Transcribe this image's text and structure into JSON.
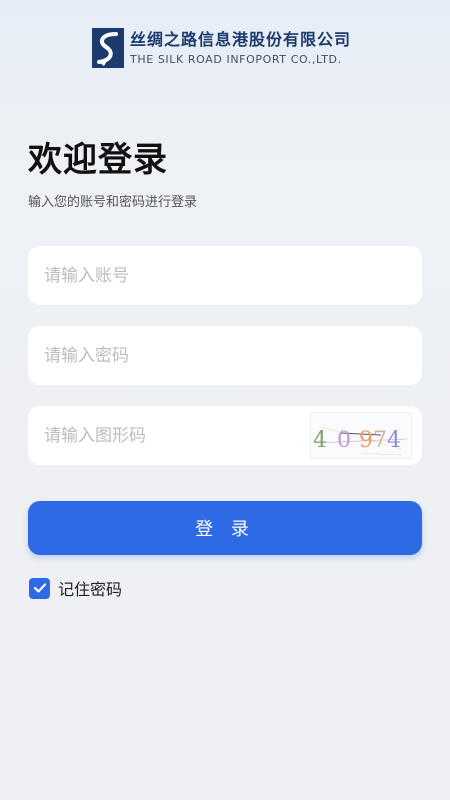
{
  "brand": {
    "name_cn": "丝绸之路信息港股份有限公司",
    "name_en": "THE SILK ROAD INFOPORT CO.,LTD."
  },
  "login": {
    "title": "欢迎登录",
    "subtitle": "输入您的账号和密码进行登录",
    "account_placeholder": "请输入账号",
    "password_placeholder": "请输入密码",
    "captcha_placeholder": "请输入图形码",
    "captcha_chars": [
      "4",
      "0",
      "9",
      "7",
      "4"
    ],
    "submit_label": "登 录",
    "remember_label": "记住密码",
    "remember_checked": true
  },
  "colors": {
    "accent": "#2f6ae6",
    "brand_navy": "#1d3a6e"
  }
}
